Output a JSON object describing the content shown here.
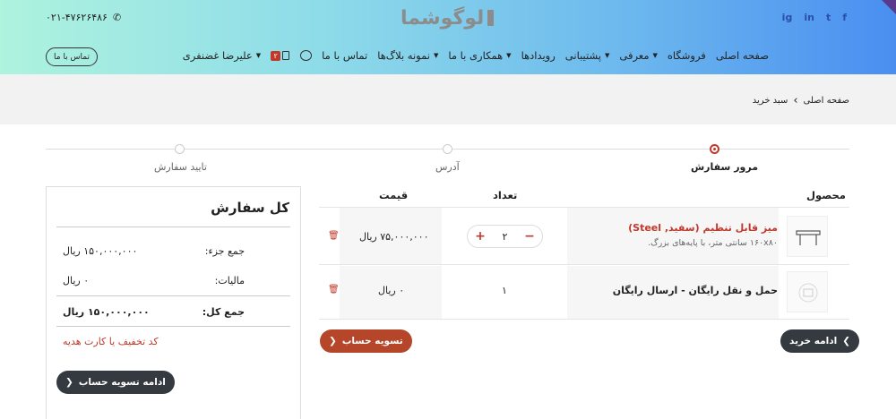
{
  "header": {
    "phone": "۰۲۱-۴۷۶۲۶۴۸۶",
    "logo": "لوگوشما",
    "social": [
      "f",
      "t",
      "in",
      "ig"
    ],
    "contact_button": "تماس با ما"
  },
  "nav": {
    "items": [
      {
        "label": "صفحه اصلی",
        "dropdown": false
      },
      {
        "label": "فروشگاه",
        "dropdown": false
      },
      {
        "label": "معرفی",
        "dropdown": true
      },
      {
        "label": "پشتیبانی",
        "dropdown": true
      },
      {
        "label": "رویدادها",
        "dropdown": false
      },
      {
        "label": "همکاری با ما",
        "dropdown": true
      },
      {
        "label": "نمونه بلاگ‌ها",
        "dropdown": true
      },
      {
        "label": "تماس با ما",
        "dropdown": false
      }
    ],
    "cart_count": "۲",
    "user_name": "علیرضا غضنفری"
  },
  "breadcrumb": {
    "home": "صفحه اصلی",
    "separator": "›",
    "current": "سبد خرید"
  },
  "steps": [
    {
      "label": "مرور سفارش",
      "active": true
    },
    {
      "label": "آدرس",
      "active": false
    },
    {
      "label": "تایید سفارش",
      "active": false
    }
  ],
  "table": {
    "headers": {
      "product": "محصول",
      "quantity": "تعداد",
      "price": "قیمت"
    },
    "rows": [
      {
        "name": "میز قابل تنظیم (سفید, Steel)",
        "subtitle": "۱۶۰x۸۰ سانتی متر، با پایه‌های بزرگ.",
        "quantity": "۲",
        "price": "۷۵,۰۰۰,۰۰۰ ریال"
      },
      {
        "name": "حمل و نقل رایگان - ارسال رایگان",
        "subtitle": "",
        "quantity": "۱",
        "price": "۰ ریال"
      }
    ]
  },
  "buttons": {
    "continue_shopping": "ادامه خرید",
    "checkout": "تسویه حساب",
    "continue_checkout": "ادامه تسویه حساب"
  },
  "summary": {
    "title": "کل سفارش",
    "subtotal_label": "جمع جزء:",
    "subtotal_value": "۱۵۰,۰۰۰,۰۰۰ ریال",
    "tax_label": "مالیات:",
    "tax_value": "۰ ریال",
    "total_label": "جمع کل:",
    "total_value": "۱۵۰,۰۰۰,۰۰۰ ریال",
    "coupon_link": "کد تخفیف یا کارت هدیه"
  },
  "colors": {
    "accent": "#c0392b",
    "dark_button": "#343a40",
    "checkout_button": "#b5462a"
  }
}
